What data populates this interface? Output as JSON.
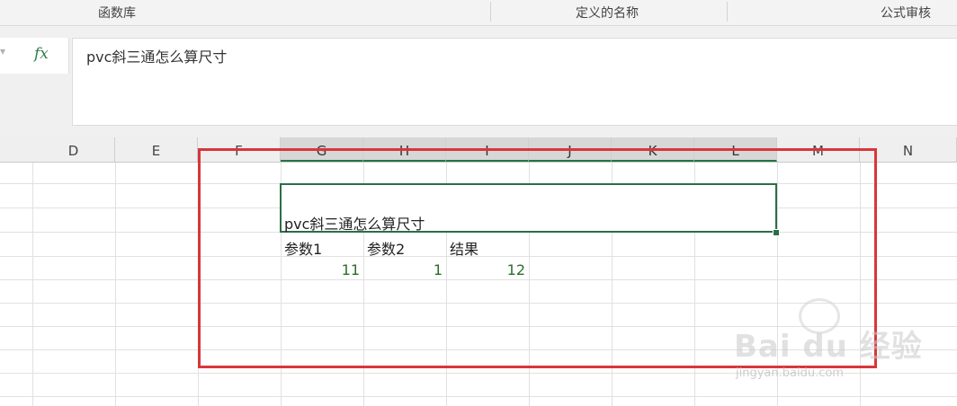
{
  "ribbon": {
    "groups": [
      "函数库",
      "定义的名称",
      "公式审核"
    ]
  },
  "formula_bar": {
    "dropdown_glyph": "▾",
    "fx_label": "fx",
    "content": "pvc斜三通怎么算尺寸"
  },
  "columns": [
    "D",
    "E",
    "F",
    "G",
    "H",
    "I",
    "J",
    "K",
    "L",
    "M",
    "N"
  ],
  "selected_columns": [
    "G",
    "H",
    "I",
    "J",
    "K",
    "L"
  ],
  "cells": {
    "title": "pvc斜三通怎么算尺寸",
    "header_1": "参数1",
    "header_2": "参数2",
    "header_3": "结果",
    "value_1": "11",
    "value_2": "1",
    "value_3": "12"
  },
  "watermark": {
    "brand": "Bai du 经验",
    "url": "jingyan.baidu.com"
  },
  "colors": {
    "accent_green": "#217346",
    "highlight_red": "#d7373b"
  }
}
